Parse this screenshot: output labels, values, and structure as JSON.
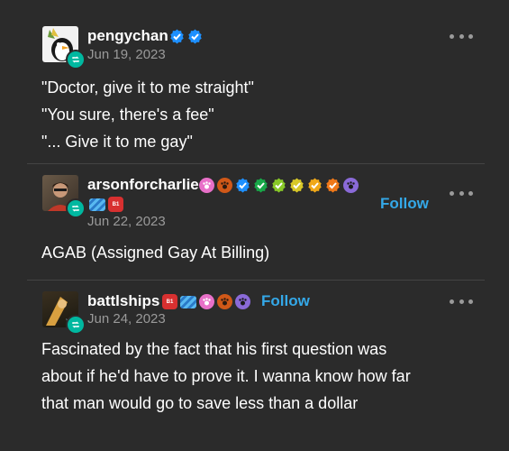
{
  "posts": [
    {
      "username": "pengychan",
      "date": "Jun 19, 2023",
      "lines": [
        "\"Doctor, give it to me straight\"",
        "\"You sure, there's a fee\"",
        "\"... Give it to me gay\""
      ],
      "avatar_colors": [
        "#f4f4f4",
        "#5a8a3a",
        "#1a1a1a"
      ],
      "badges": [
        "blue-check-badge",
        "blue-check-badge"
      ]
    },
    {
      "username": "arsonforcharlie",
      "date": "Jun 22, 2023",
      "follow": "Follow",
      "text": "AGAB (Assigned Gay At Billing)",
      "avatar_colors": [
        "#5a4a3a",
        "#c04030"
      ],
      "badges": [
        "pink-paw-badge",
        "orange-paw-badge",
        "blue-check-badge",
        "green-check-badge",
        "lime-check-badge",
        "yellow-check-badge",
        "gold-check-badge",
        "orange-check-badge",
        "purple-paw-badge",
        "blue-striped-badge",
        "red-octagon-badge"
      ]
    },
    {
      "username": "battlships",
      "date": "Jun 24, 2023",
      "follow": "Follow",
      "lines": [
        "Fascinated by the fact that his first question was",
        "about if he'd have to prove it. I wanna know how far",
        "that man would go to save less than a dollar"
      ],
      "avatar_colors": [
        "#3a3020",
        "#d8a040"
      ],
      "badges": [
        "red-octagon-badge",
        "blue-striped-badge",
        "pink-paw-badge",
        "orange-paw-badge",
        "purple-paw-badge"
      ]
    }
  ],
  "colors": {
    "background": "#2b2b2b",
    "follow": "#34a8e8",
    "reblog": "#00b8a0",
    "verified": "#1e90ff"
  }
}
